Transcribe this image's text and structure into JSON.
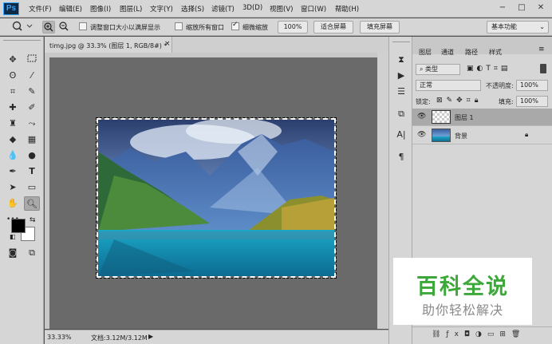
{
  "app": {
    "logo": "Ps"
  },
  "menu": [
    "文件(F)",
    "编辑(E)",
    "图像(I)",
    "图层(L)",
    "文字(Y)",
    "选择(S)",
    "滤镜(T)",
    "3D(D)",
    "视图(V)",
    "窗口(W)",
    "帮助(H)"
  ],
  "window_buttons": {
    "minimize": "−",
    "maximize": "□",
    "close": "✕"
  },
  "options": {
    "fit_window_label": "调整窗口大小以满屏显示",
    "zoom_all_label": "缩放所有窗口",
    "scrubby_label": "细微缩放",
    "zoom_value": "100%",
    "fit_screen": "适合屏幕",
    "fill_screen": "填充屏幕",
    "workspace": "基本功能",
    "fit_window_checked": false,
    "zoom_all_checked": false,
    "scrubby_checked": true
  },
  "document": {
    "tab_title": "timg.jpg @ 33.3% (图层 1, RGB/8#) *",
    "status_zoom": "33.33%",
    "status_doc": "文档:3.12M/3.12M"
  },
  "layers_panel": {
    "tabs": [
      "图层",
      "通道",
      "路径",
      "样式"
    ],
    "filter_kind": "类型",
    "blend_mode": "正常",
    "opacity_label": "不透明度:",
    "opacity_value": "100%",
    "lock_label": "锁定:",
    "fill_label": "填充:",
    "fill_value": "100%",
    "layers": [
      {
        "name": "图层 1",
        "selected": true
      },
      {
        "name": "背景",
        "selected": false
      }
    ]
  },
  "watermark": {
    "title": "百科全说",
    "subtitle": "助你轻松解决"
  },
  "colors": {
    "panel": "#d6d6d6",
    "workspace": "#535353",
    "canvas_bg": "#6a6a6a",
    "accent": "#31a8ff",
    "watermark_green": "#3da83a"
  }
}
